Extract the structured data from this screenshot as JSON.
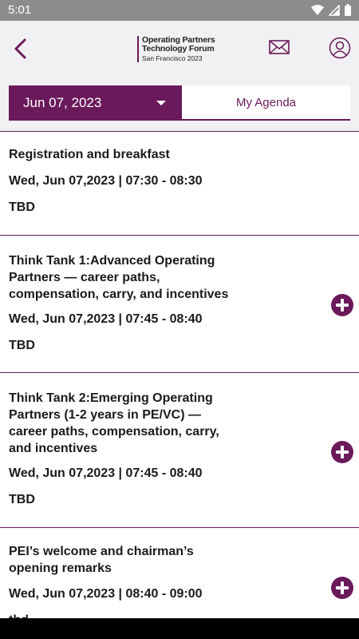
{
  "status_bar": {
    "time": "5:01"
  },
  "header": {
    "logo": {
      "line1": "Operating Partners",
      "line2": "Technology Forum",
      "line3": "San Francisco 2023"
    }
  },
  "tabs": {
    "date_label": "Jun 07, 2023",
    "agenda_label": "My Agenda"
  },
  "sessions": [
    {
      "title": "Registration and breakfast",
      "time": "Wed, Jun 07,2023 | 07:30 - 08:30",
      "location": "TBD"
    },
    {
      "title": "Think Tank 1:Advanced Operating Partners — career paths, compensation, carry, and incentives",
      "time": "Wed, Jun 07,2023 | 07:45 - 08:40",
      "location": "TBD"
    },
    {
      "title": "Think Tank 2:Emerging Operating Partners (1-2 years in PE/VC) — career paths, compensation, carry, and incentives",
      "time": "Wed, Jun 07,2023 | 07:45 - 08:40",
      "location": "TBD"
    },
    {
      "title": "PEI’s welcome and chairman’s opening remarks",
      "time": "Wed, Jun 07,2023 | 08:40 - 09:00",
      "location": "tbd"
    }
  ],
  "colors": {
    "accent": "#6a1a5a",
    "header_bg": "#f1f0f3",
    "status_bar": "#8c8c8c"
  }
}
